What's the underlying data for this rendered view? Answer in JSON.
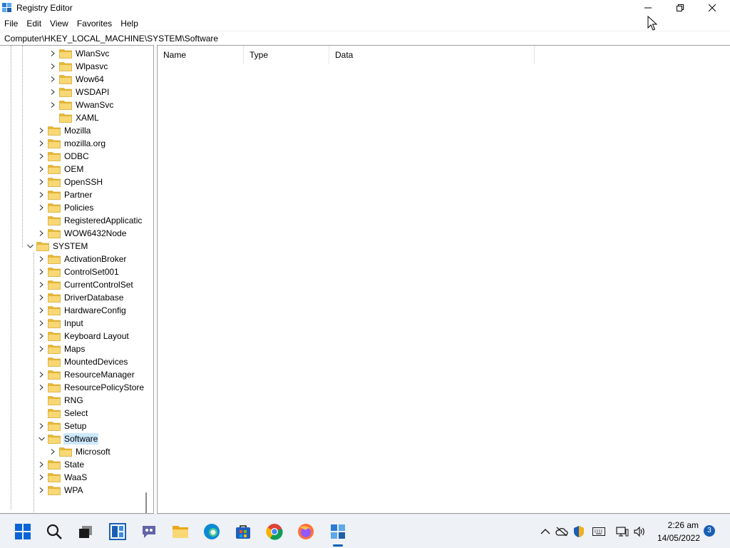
{
  "window": {
    "title": "Registry Editor"
  },
  "menu": [
    "File",
    "Edit",
    "View",
    "Favorites",
    "Help"
  ],
  "address": "Computer\\HKEY_LOCAL_MACHINE\\SYSTEM\\Software",
  "tree": [
    {
      "label": "WlanSvc",
      "depth": 2,
      "expandable": true,
      "expanded": false
    },
    {
      "label": "Wlpasvc",
      "depth": 2,
      "expandable": true,
      "expanded": false
    },
    {
      "label": "Wow64",
      "depth": 2,
      "expandable": true,
      "expanded": false
    },
    {
      "label": "WSDAPI",
      "depth": 2,
      "expandable": true,
      "expanded": false
    },
    {
      "label": "WwanSvc",
      "depth": 2,
      "expandable": true,
      "expanded": false
    },
    {
      "label": "XAML",
      "depth": 2,
      "expandable": false,
      "expanded": false
    },
    {
      "label": "Mozilla",
      "depth": 1,
      "expandable": true,
      "expanded": false
    },
    {
      "label": "mozilla.org",
      "depth": 1,
      "expandable": true,
      "expanded": false
    },
    {
      "label": "ODBC",
      "depth": 1,
      "expandable": true,
      "expanded": false
    },
    {
      "label": "OEM",
      "depth": 1,
      "expandable": true,
      "expanded": false
    },
    {
      "label": "OpenSSH",
      "depth": 1,
      "expandable": true,
      "expanded": false
    },
    {
      "label": "Partner",
      "depth": 1,
      "expandable": true,
      "expanded": false
    },
    {
      "label": "Policies",
      "depth": 1,
      "expandable": true,
      "expanded": false
    },
    {
      "label": "RegisteredApplicatic",
      "depth": 1,
      "expandable": false,
      "expanded": false
    },
    {
      "label": "WOW6432Node",
      "depth": 1,
      "expandable": true,
      "expanded": false
    },
    {
      "label": "SYSTEM",
      "depth": 0,
      "expandable": true,
      "expanded": true
    },
    {
      "label": "ActivationBroker",
      "depth": 1,
      "expandable": true,
      "expanded": false
    },
    {
      "label": "ControlSet001",
      "depth": 1,
      "expandable": true,
      "expanded": false
    },
    {
      "label": "CurrentControlSet",
      "depth": 1,
      "expandable": true,
      "expanded": false
    },
    {
      "label": "DriverDatabase",
      "depth": 1,
      "expandable": true,
      "expanded": false
    },
    {
      "label": "HardwareConfig",
      "depth": 1,
      "expandable": true,
      "expanded": false
    },
    {
      "label": "Input",
      "depth": 1,
      "expandable": true,
      "expanded": false
    },
    {
      "label": "Keyboard Layout",
      "depth": 1,
      "expandable": true,
      "expanded": false
    },
    {
      "label": "Maps",
      "depth": 1,
      "expandable": true,
      "expanded": false
    },
    {
      "label": "MountedDevices",
      "depth": 1,
      "expandable": false,
      "expanded": false
    },
    {
      "label": "ResourceManager",
      "depth": 1,
      "expandable": true,
      "expanded": false
    },
    {
      "label": "ResourcePolicyStore",
      "depth": 1,
      "expandable": true,
      "expanded": false
    },
    {
      "label": "RNG",
      "depth": 1,
      "expandable": false,
      "expanded": false
    },
    {
      "label": "Select",
      "depth": 1,
      "expandable": false,
      "expanded": false
    },
    {
      "label": "Setup",
      "depth": 1,
      "expandable": true,
      "expanded": false
    },
    {
      "label": "Software",
      "depth": 1,
      "expandable": true,
      "expanded": true,
      "selected": true
    },
    {
      "label": "Microsoft",
      "depth": 2,
      "expandable": true,
      "expanded": false
    },
    {
      "label": "State",
      "depth": 1,
      "expandable": true,
      "expanded": false
    },
    {
      "label": "WaaS",
      "depth": 1,
      "expandable": true,
      "expanded": false
    },
    {
      "label": "WPA",
      "depth": 1,
      "expandable": true,
      "expanded": false
    }
  ],
  "columns": {
    "name": "Name",
    "type": "Type",
    "data": "Data"
  },
  "taskbar": {
    "apps": [
      "start-icon",
      "search-icon",
      "task-view-icon",
      "widgets-icon",
      "teams-chat-icon",
      "file-explorer-icon",
      "edge-icon",
      "store-icon",
      "chrome-icon",
      "firefox-icon",
      "registry-editor-icon"
    ],
    "time": "2:26 am",
    "date": "14/05/2022",
    "notifications": "3"
  },
  "colors": {
    "selection": "#cce8ff",
    "folder": "#f8d775",
    "accent": "#005fb8"
  }
}
